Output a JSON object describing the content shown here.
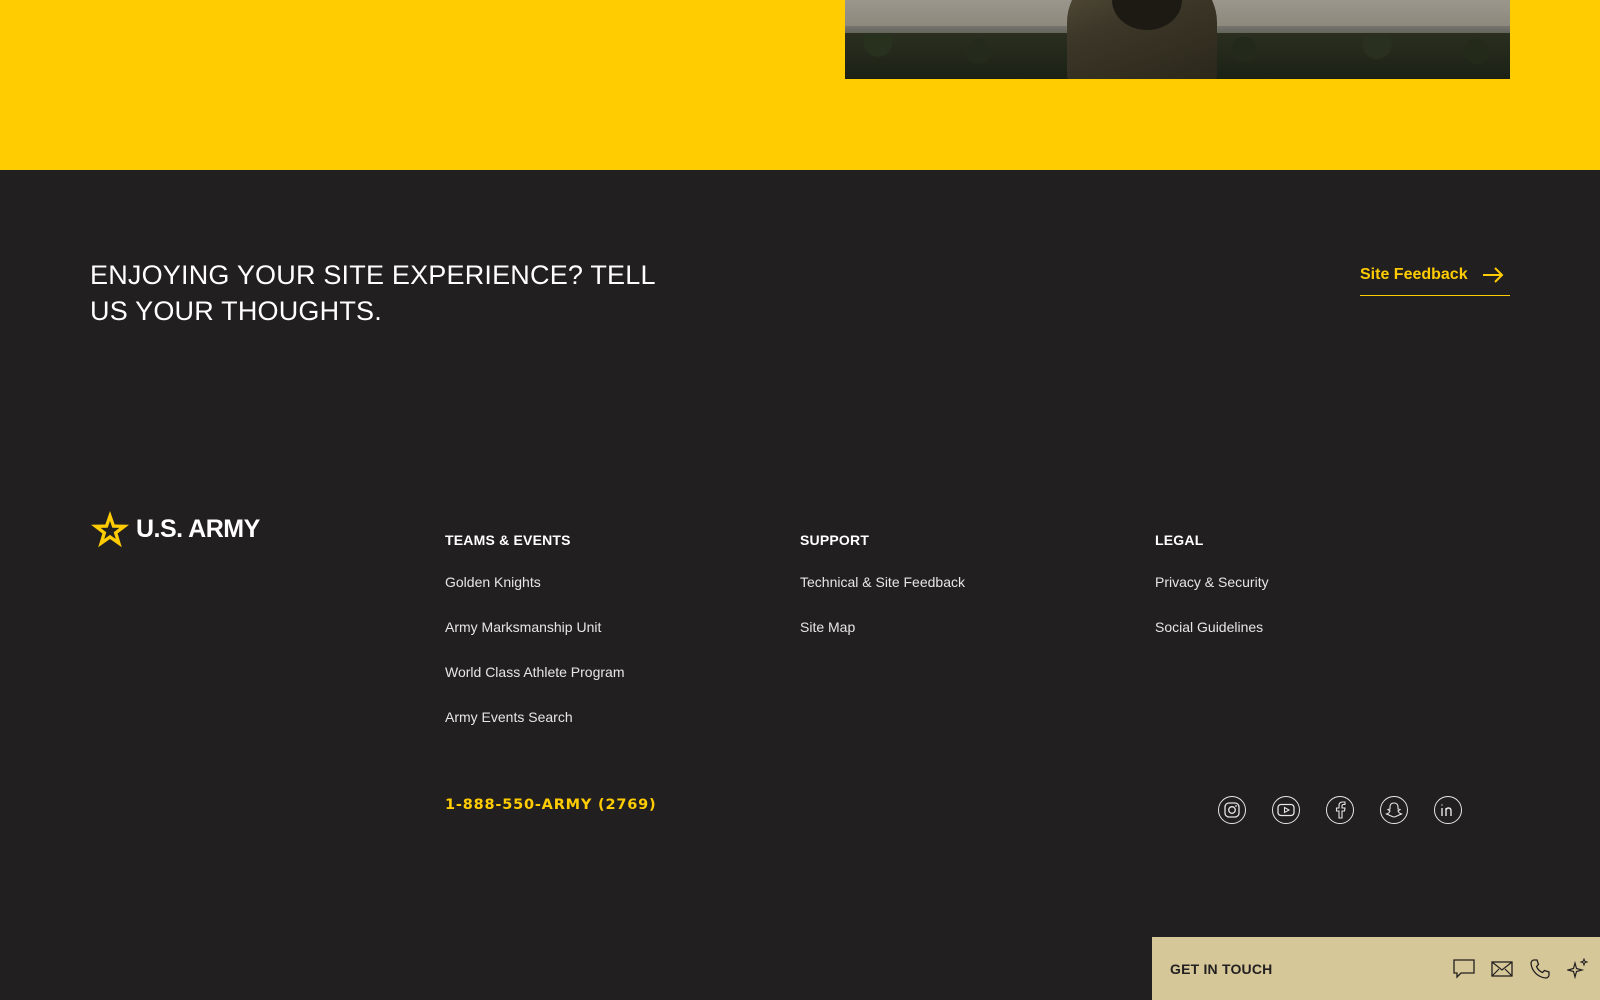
{
  "colors": {
    "accent": "#ffcc01",
    "footer_bg": "#221f20",
    "cta_bg": "#d6c799"
  },
  "feedback": {
    "heading": "ENJOYING YOUR SITE EXPERIENCE?  TELL US YOUR THOUGHTS.",
    "link_label": "Site Feedback",
    "link_icon": "arrow-right-icon"
  },
  "logo": {
    "text": "U.S. ARMY",
    "icon": "star-icon"
  },
  "columns": [
    {
      "heading": "TEAMS & EVENTS",
      "links": [
        "Golden Knights",
        "Army Marksmanship Unit",
        "World Class Athlete Program",
        "Army Events Search"
      ]
    },
    {
      "heading": "SUPPORT",
      "links": [
        "Technical & Site Feedback",
        "Site Map"
      ]
    },
    {
      "heading": "LEGAL",
      "links": [
        "Privacy & Security",
        "Social Guidelines"
      ]
    }
  ],
  "phone": "1-888-550-ARMY (2769)",
  "social": [
    "instagram-icon",
    "youtube-icon",
    "facebook-icon",
    "snapchat-icon",
    "linkedin-icon"
  ],
  "get_in_touch": {
    "label": "GET IN TOUCH",
    "icons": [
      "chat-icon",
      "email-icon",
      "phone-icon",
      "sparkle-icon"
    ]
  }
}
